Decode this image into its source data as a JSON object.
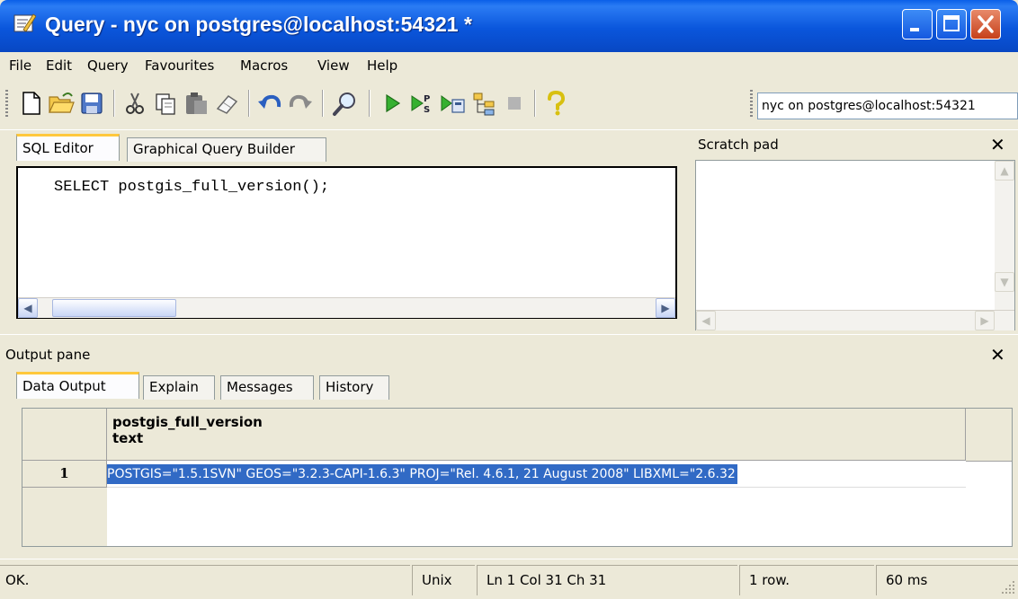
{
  "window": {
    "title": "Query - nyc on postgres@localhost:54321 *"
  },
  "menu": [
    "File",
    "Edit",
    "Query",
    "Favourites",
    "Macros",
    "View",
    "Help"
  ],
  "toolbar": {
    "connection": "nyc on postgres@localhost:54321"
  },
  "editor": {
    "tabs": [
      "SQL Editor",
      "Graphical Query Builder"
    ],
    "code": "SELECT postgis_full_version();"
  },
  "scratch": {
    "label": "Scratch pad",
    "close": "✕"
  },
  "output": {
    "label": "Output pane",
    "close": "✕",
    "tabs": [
      "Data Output",
      "Explain",
      "Messages",
      "History"
    ],
    "column_name": "postgis_full_version",
    "column_type": "text",
    "rows": [
      {
        "num": "1",
        "value": "POSTGIS=\"1.5.1SVN\" GEOS=\"3.2.3-CAPI-1.6.3\" PROJ=\"Rel. 4.6.1, 21 August 2008\" LIBXML=\"2.6.32"
      }
    ]
  },
  "status": {
    "message": "OK.",
    "line_ending": "Unix",
    "position": "Ln 1 Col 31 Ch 31",
    "rows": "1 row.",
    "time": "60 ms"
  },
  "colors": {
    "titlebar": "#0a56dc",
    "selection": "#316ac5",
    "tab_highlight": "#ffc83c"
  }
}
